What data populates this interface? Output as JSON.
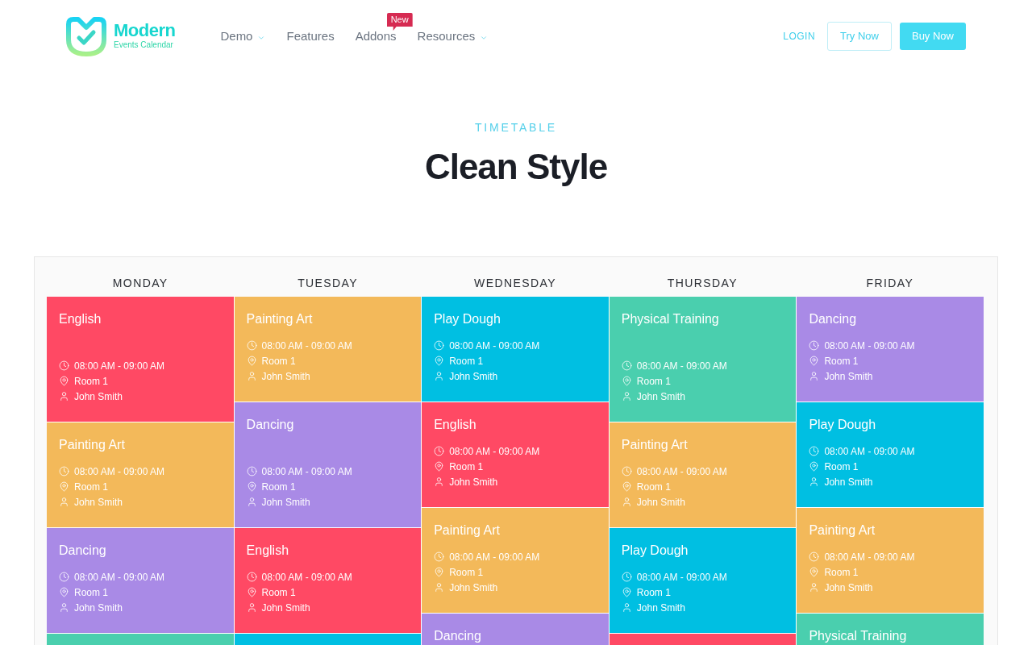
{
  "header": {
    "logo": {
      "name": "Modern",
      "tagline": "Events Calendar"
    },
    "nav": [
      {
        "label": "Demo",
        "dropdown": true
      },
      {
        "label": "Features",
        "dropdown": false
      },
      {
        "label": "Addons",
        "dropdown": false,
        "badge": "New"
      },
      {
        "label": "Resources",
        "dropdown": true
      }
    ],
    "login": "LOGIN",
    "buttons": [
      {
        "label": "Try Now",
        "kind": "outline"
      },
      {
        "label": "Buy Now",
        "kind": "filled"
      }
    ]
  },
  "section": {
    "eyebrow": "TIMETABLE",
    "title": "Clean Style"
  },
  "timetable": {
    "days": [
      {
        "name": "MONDAY",
        "events": [
          {
            "kind": "tall",
            "color": "#ff4964",
            "title": "English",
            "time": "08:00 AM - 09:00 AM",
            "room": "Room 1",
            "host": "John Smith"
          },
          {
            "kind": "regular",
            "color": "#f3b95a",
            "title": "Painting Art",
            "time": "08:00 AM - 09:00 AM",
            "room": "Room 1",
            "host": "John Smith"
          },
          {
            "kind": "regular",
            "color": "#a98ae6",
            "title": "Dancing",
            "time": "08:00 AM - 09:00 AM",
            "room": "Room 1",
            "host": "John Smith"
          },
          {
            "kind": "partial",
            "color": "#4acfae"
          }
        ]
      },
      {
        "name": "TUESDAY",
        "events": [
          {
            "kind": "regular",
            "color": "#f3b95a",
            "title": "Painting Art",
            "time": "08:00 AM - 09:00 AM",
            "room": "Room 1",
            "host": "John Smith"
          },
          {
            "kind": "tall",
            "color": "#a98ae6",
            "title": "Dancing",
            "time": "08:00 AM - 09:00 AM",
            "room": "Room 1",
            "host": "John Smith"
          },
          {
            "kind": "regular",
            "color": "#ff4964",
            "title": "English",
            "time": "08:00 AM - 09:00 AM",
            "room": "Room 1",
            "host": "John Smith"
          },
          {
            "kind": "partial",
            "color": "#00bfe2"
          }
        ]
      },
      {
        "name": "WEDNESDAY",
        "events": [
          {
            "kind": "regular",
            "color": "#00bfe2",
            "title": "Play Dough",
            "time": "08:00 AM - 09:00 AM",
            "room": "Room 1",
            "host": "John Smith"
          },
          {
            "kind": "regular",
            "color": "#ff4964",
            "title": "English",
            "time": "08:00 AM - 09:00 AM",
            "room": "Room 1",
            "host": "John Smith"
          },
          {
            "kind": "regular",
            "color": "#f3b95a",
            "title": "Painting Art",
            "time": "08:00 AM - 09:00 AM",
            "room": "Room 1",
            "host": "John Smith"
          },
          {
            "kind": "partial",
            "color": "#a98ae6",
            "title": "Dancing"
          }
        ]
      },
      {
        "name": "THURSDAY",
        "events": [
          {
            "kind": "tall",
            "color": "#4acfae",
            "title": "Physical Training",
            "time": "08:00 AM - 09:00 AM",
            "room": "Room 1",
            "host": "John Smith"
          },
          {
            "kind": "regular",
            "color": "#f3b95a",
            "title": "Painting Art",
            "time": "08:00 AM - 09:00 AM",
            "room": "Room 1",
            "host": "John Smith"
          },
          {
            "kind": "regular",
            "color": "#00bfe2",
            "title": "Play Dough",
            "time": "08:00 AM - 09:00 AM",
            "room": "Room 1",
            "host": "John Smith"
          },
          {
            "kind": "partial",
            "color": "#ff4964"
          }
        ]
      },
      {
        "name": "FRIDAY",
        "events": [
          {
            "kind": "regular",
            "color": "#a98ae6",
            "title": "Dancing",
            "time": "08:00 AM - 09:00 AM",
            "room": "Room 1",
            "host": "John Smith"
          },
          {
            "kind": "regular",
            "color": "#00bfe2",
            "title": "Play Dough",
            "time": "08:00 AM - 09:00 AM",
            "room": "Room 1",
            "host": "John Smith"
          },
          {
            "kind": "regular",
            "color": "#f3b95a",
            "title": "Painting Art",
            "time": "08:00 AM - 09:00 AM",
            "room": "Room 1",
            "host": "John Smith"
          },
          {
            "kind": "partial",
            "color": "#4acfae",
            "title": "Physical Training"
          }
        ]
      }
    ]
  }
}
